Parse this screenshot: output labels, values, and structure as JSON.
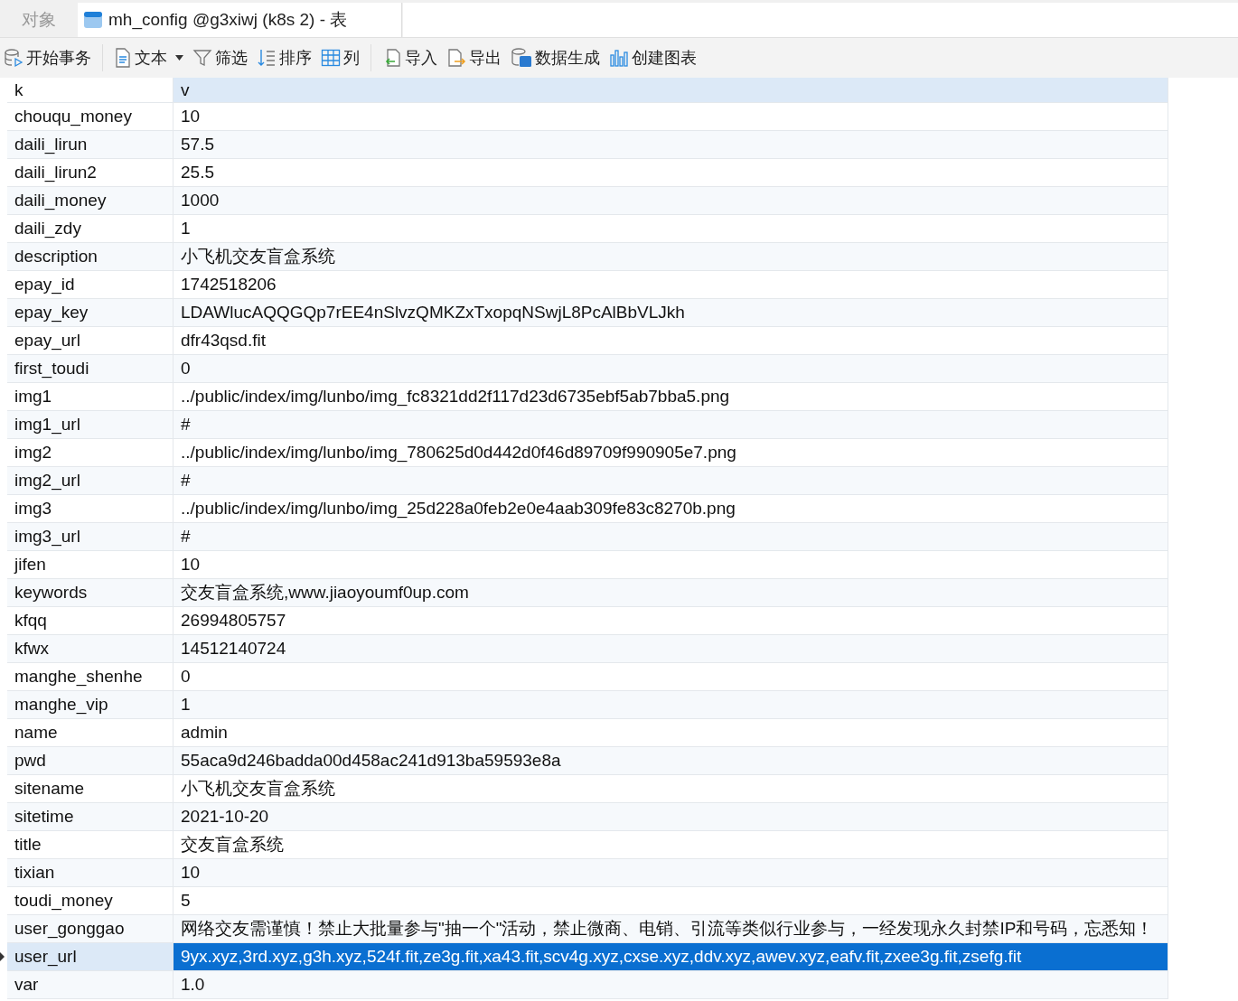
{
  "tabs": [
    {
      "label": "对象",
      "selected": false
    },
    {
      "label": "mh_config @g3xiwj (k8s 2) - 表",
      "selected": true
    }
  ],
  "toolbar": [
    [
      {
        "label": "开始事务"
      }
    ],
    [
      {
        "label": "文本"
      },
      {
        "label": "筛选"
      },
      {
        "label": "排序"
      },
      {
        "label": "列"
      }
    ],
    [
      {
        "label": "导入"
      },
      {
        "label": "导出"
      },
      {
        "label": "数据生成"
      },
      {
        "label": "创建图表"
      }
    ]
  ],
  "table": {
    "columns": [
      {
        "label": "k",
        "selected": false
      },
      {
        "label": "v",
        "selected": true
      }
    ],
    "rows": [
      {
        "k": "chouqu_money",
        "v": "10",
        "selected": false
      },
      {
        "k": "daili_lirun",
        "v": "57.5",
        "selected": false
      },
      {
        "k": "daili_lirun2",
        "v": "25.5",
        "selected": false
      },
      {
        "k": "daili_money",
        "v": "1000",
        "selected": false
      },
      {
        "k": "daili_zdy",
        "v": "1",
        "selected": false
      },
      {
        "k": "description",
        "v": "小飞机交友盲盒系统",
        "selected": false
      },
      {
        "k": "epay_id",
        "v": "1742518206",
        "selected": false
      },
      {
        "k": "epay_key",
        "v": "LDAWlucAQQGQp7rEE4nSlvzQMKZxTxopqNSwjL8PcAlBbVLJkh",
        "selected": false
      },
      {
        "k": "epay_url",
        "v": "dfr43qsd.fit",
        "selected": false
      },
      {
        "k": "first_toudi",
        "v": "0",
        "selected": false
      },
      {
        "k": "img1",
        "v": "../public/index/img/lunbo/img_fc8321dd2f117d23d6735ebf5ab7bba5.png",
        "selected": false
      },
      {
        "k": "img1_url",
        "v": "#",
        "selected": false
      },
      {
        "k": "img2",
        "v": "../public/index/img/lunbo/img_780625d0d442d0f46d89709f990905e7.png",
        "selected": false
      },
      {
        "k": "img2_url",
        "v": "#",
        "selected": false
      },
      {
        "k": "img3",
        "v": "../public/index/img/lunbo/img_25d228a0feb2e0e4aab309fe83c8270b.png",
        "selected": false
      },
      {
        "k": "img3_url",
        "v": "#",
        "selected": false
      },
      {
        "k": "jifen",
        "v": "10",
        "selected": false
      },
      {
        "k": "keywords",
        "v": "交友盲盒系统,www.jiaoyoumf0up.com",
        "selected": false
      },
      {
        "k": "kfqq",
        "v": "26994805757",
        "selected": false
      },
      {
        "k": "kfwx",
        "v": "14512140724",
        "selected": false
      },
      {
        "k": "manghe_shenhe",
        "v": "0",
        "selected": false
      },
      {
        "k": "manghe_vip",
        "v": "1",
        "selected": false
      },
      {
        "k": "name",
        "v": "admin",
        "selected": false
      },
      {
        "k": "pwd",
        "v": "55aca9d246badda00d458ac241d913ba59593e8a",
        "selected": false
      },
      {
        "k": "sitename",
        "v": "小飞机交友盲盒系统",
        "selected": false
      },
      {
        "k": "sitetime",
        "v": "2021-10-20",
        "selected": false
      },
      {
        "k": "title",
        "v": "交友盲盒系统",
        "selected": false
      },
      {
        "k": "tixian",
        "v": "10",
        "selected": false
      },
      {
        "k": "toudi_money",
        "v": "5",
        "selected": false
      },
      {
        "k": "user_gonggao",
        "v": "网络交友需谨慎！禁止大批量参与\"抽一个\"活动，禁止微商、电销、引流等类似行业参与，一经发现永久封禁IP和号码，忘悉知！",
        "selected": false
      },
      {
        "k": "user_url",
        "v": "9yx.xyz,3rd.xyz,g3h.xyz,524f.fit,ze3g.fit,xa43.fit,scv4g.xyz,cxse.xyz,ddv.xyz,awev.xyz,eafv.fit,zxee3g.fit,zsefg.fit",
        "selected": true
      },
      {
        "k": "var",
        "v": "1.0",
        "selected": false
      }
    ]
  }
}
